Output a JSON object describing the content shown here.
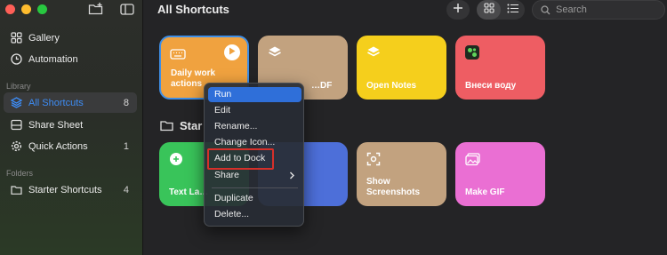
{
  "window": {
    "title": "All Shortcuts"
  },
  "sidebar": {
    "items_top": [
      {
        "label": "Gallery",
        "icon": "gallery-icon"
      },
      {
        "label": "Automation",
        "icon": "clock-icon"
      }
    ],
    "library_heading": "Library",
    "library_items": [
      {
        "label": "All Shortcuts",
        "count": "8",
        "icon": "shortcuts-icon"
      },
      {
        "label": "Share Sheet",
        "count": "",
        "icon": "share-sheet-icon"
      },
      {
        "label": "Quick Actions",
        "count": "1",
        "icon": "gear-icon"
      }
    ],
    "folders_heading": "Folders",
    "folder_items": [
      {
        "label": "Starter Shortcuts",
        "count": "4",
        "icon": "folder-icon"
      }
    ]
  },
  "toolbar": {
    "search_placeholder": "Search"
  },
  "shortcuts_row1": [
    {
      "title_line1": "Daily work",
      "title_line2": "actions",
      "color": "#f0a23f",
      "icon": "keyboard-icon"
    },
    {
      "title_line1": "",
      "title_line2": "…DF",
      "color": "#c2a27f",
      "icon": "layers-icon"
    },
    {
      "title_line1": "",
      "title_line2": "Open Notes",
      "color": "#f5cf1c",
      "icon": "layers-icon"
    },
    {
      "title_line1": "",
      "title_line2": "Внеси воду",
      "color": "#ee5d63",
      "icon": "app-icon"
    }
  ],
  "section": {
    "title": "Starter Shortcuts",
    "visible_title": "Star"
  },
  "shortcuts_row2": [
    {
      "title_line1": "",
      "title_line2": "Text La…",
      "color": "#39c45a",
      "icon": "message-icon"
    },
    {
      "title_line1": "",
      "title_line2": "",
      "color": "#4d6fd9",
      "icon": ""
    },
    {
      "title_line1": "Show",
      "title_line2": "Screenshots",
      "color": "#c2a27f",
      "icon": "screenshot-icon"
    },
    {
      "title_line1": "",
      "title_line2": "Make GIF",
      "color": "#ea6fd3",
      "icon": "photos-icon"
    }
  ],
  "context_menu": {
    "group1": [
      "Run",
      "Edit",
      "Rename...",
      "Change Icon...",
      "Add to Dock"
    ],
    "share": "Share",
    "group2": [
      "Duplicate",
      "Delete..."
    ],
    "highlight_color": "#2f6fd9",
    "annotation_color": "#d6302a"
  }
}
